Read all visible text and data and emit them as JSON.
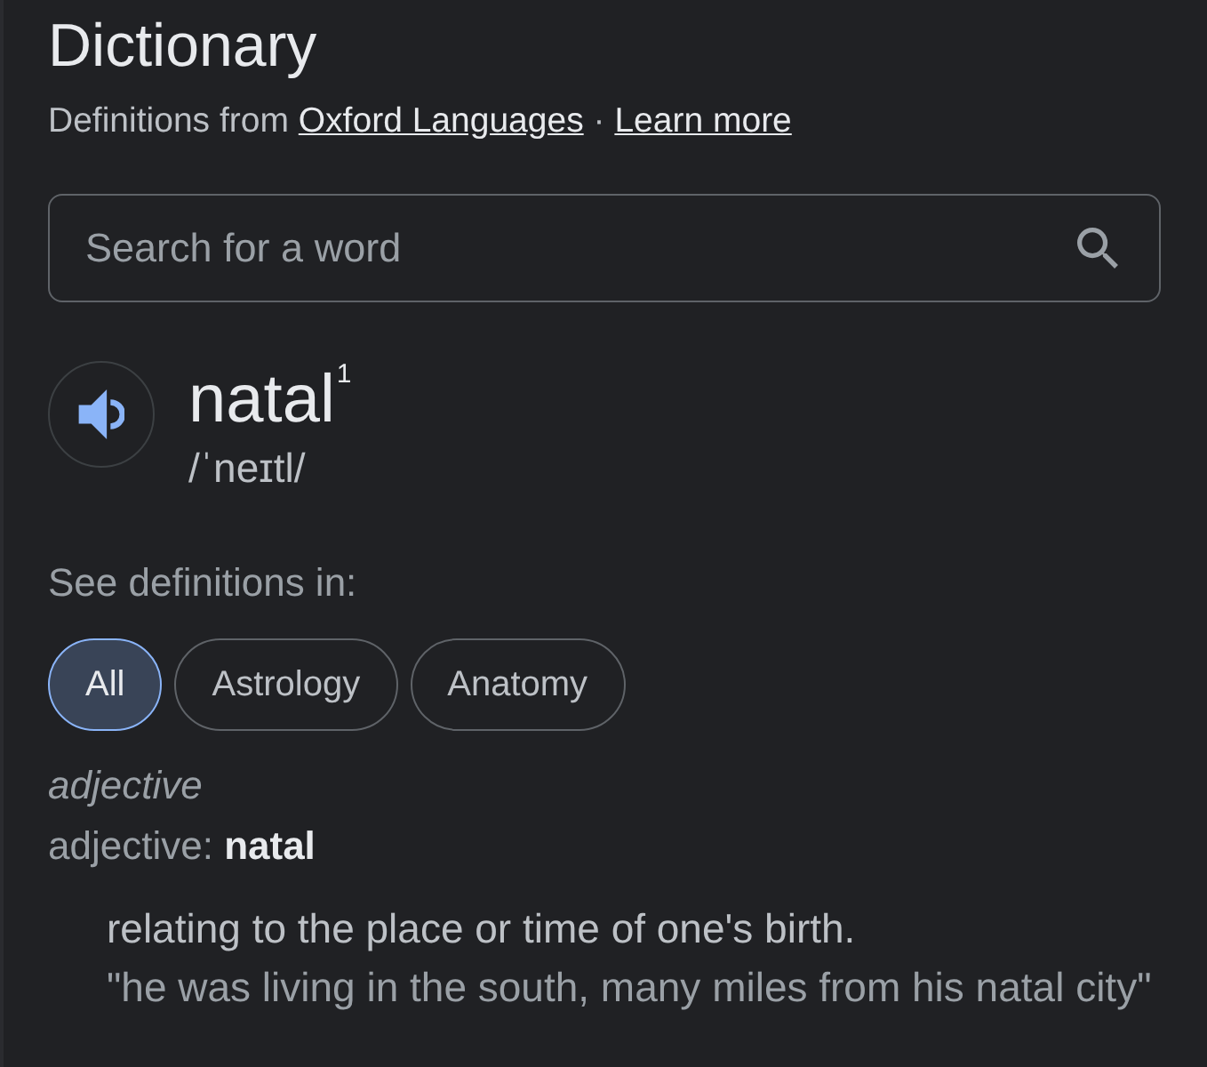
{
  "header": {
    "title": "Dictionary",
    "attribution": {
      "prefix": "Definitions from",
      "links": [
        "Oxford Languages",
        "Learn more"
      ],
      "separator": "·"
    }
  },
  "search": {
    "placeholder": "Search for a word"
  },
  "entry": {
    "word": "natal$^{1}$",
    "pronunciation": "/ˈneɪtl/"
  },
  "filters": {
    "label": "See definitions in:",
    "chips": [
      {
        "label": "All",
        "selected": true
      },
      {
        "label": "Astrology",
        "selected": false
      },
      {
        "label": "Anatomy",
        "selected": false
      }
    ]
  },
  "sense_group": {
    "part_of_speech": "adjective",
    "forms": "adjective: **natal**",
    "senses": [
      {
        "definition": "relating to the place or time of one's birth.",
        "example": "\"he was living in the south, many miles from his natal city\""
      }
    ]
  }
}
